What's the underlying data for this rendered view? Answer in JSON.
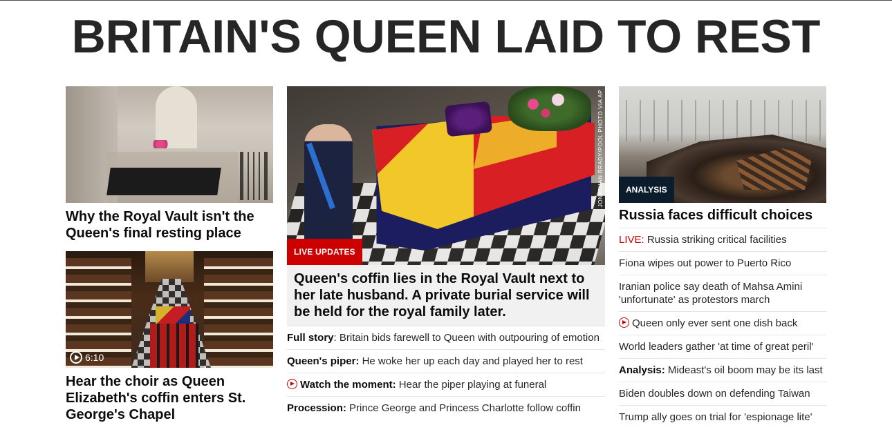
{
  "headline": "BRITAIN'S QUEEN LAID TO REST",
  "left": {
    "story1": {
      "title": "Why the Royal Vault isn't the Queen's final resting place"
    },
    "story2": {
      "title": "Hear the choir as Queen Elizabeth's coffin enters St. George's Chapel",
      "video_duration": "6:10"
    }
  },
  "center": {
    "label": "LIVE UPDATES",
    "photo_credit": "JONATHAN BRADY/POOL PHOTO VIA AP",
    "title": "Queen's coffin lies in the Royal Vault next to her late husband. A private burial service will be held for the royal family later.",
    "links": [
      {
        "prefix": "Full story",
        "sep": ": ",
        "text": "Britain bids farewell to Queen with outpouring of emotion"
      },
      {
        "prefix": "Queen's piper:",
        "sep": " ",
        "text": "He woke her up each day and played her to rest"
      },
      {
        "prefix": "Watch the moment:",
        "sep": " ",
        "text": "Hear the piper playing at funeral",
        "icon": "play-icon"
      },
      {
        "prefix": "Procession:",
        "sep": " ",
        "text": "Prince George and Princess Charlotte follow coffin"
      }
    ]
  },
  "right": {
    "label": "ANALYSIS",
    "title": "Russia faces difficult choices",
    "links": [
      {
        "live": "LIVE:",
        "text": " Russia striking critical facilities"
      },
      {
        "text": "Fiona wipes out power to Puerto Rico"
      },
      {
        "text": "Iranian police say death of Mahsa Amini 'unfortunate' as protestors march"
      },
      {
        "icon": "play-icon",
        "text": "Queen only ever sent one dish back"
      },
      {
        "text": "World leaders gather 'at time of great peril'"
      },
      {
        "bold": "Analysis:",
        "text": " Mideast's oil boom may be its last"
      },
      {
        "text": "Biden doubles down on defending Taiwan"
      },
      {
        "text": "Trump ally goes on trial for 'espionage lite'"
      }
    ]
  },
  "colors": {
    "live_red": "#cc0000",
    "analysis_navy": "#0b1d2d",
    "text": "#0c0c0c"
  }
}
